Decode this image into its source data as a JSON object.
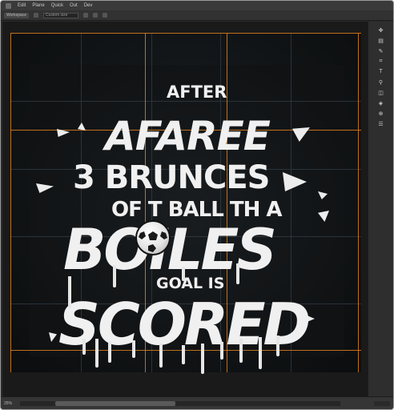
{
  "menubar": {
    "items": [
      "Edit",
      "Plane",
      "Quick",
      "Out",
      "Dev"
    ]
  },
  "optionsbar": {
    "preset_label": "Workspace",
    "field_placeholder": "Custom size"
  },
  "artwork": {
    "lines": [
      "AFTER",
      "AFAREE",
      "3 BRUNCES",
      "OF T BALL TH A",
      "BOILES",
      "GOAL IS",
      "SCORED"
    ]
  },
  "right_toolbar": {
    "tools": [
      "move-icon",
      "layers-icon",
      "brush-icon",
      "crop-icon",
      "text-icon",
      "eyedropper-icon",
      "eraser-icon",
      "fill-icon",
      "zoom-icon",
      "hand-icon"
    ]
  },
  "statusbar": {
    "zoom": "25%"
  },
  "colors": {
    "guide": "#d47a1e",
    "canvas_bg": "#111416",
    "text": "#f0f0f0"
  }
}
